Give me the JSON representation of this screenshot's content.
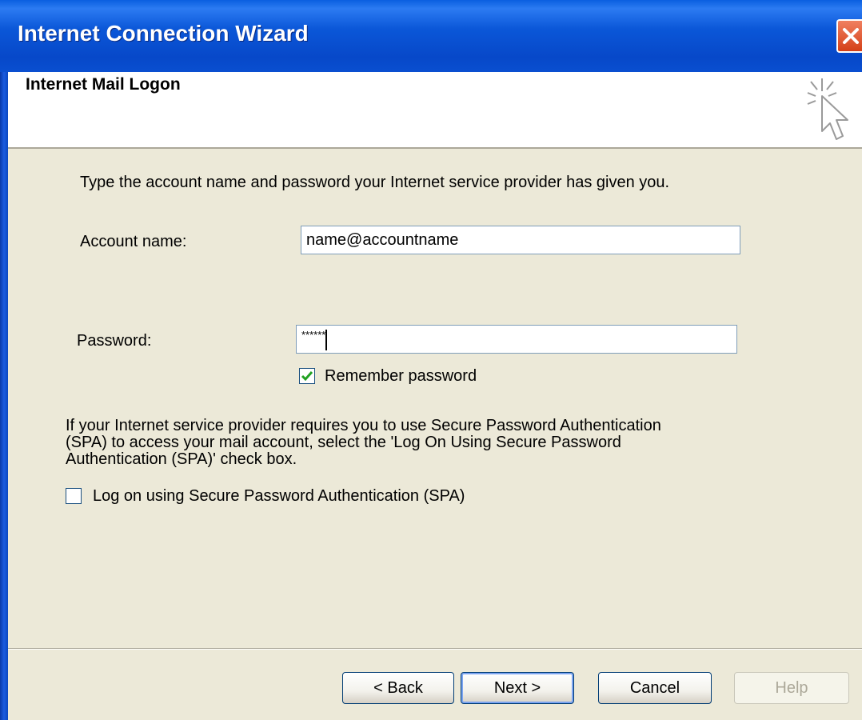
{
  "window": {
    "title": "Internet Connection Wizard"
  },
  "header": {
    "title": "Internet Mail Logon"
  },
  "content": {
    "intro": "Type the account name and password your Internet service provider has given you.",
    "account_label": "Account name:",
    "account_value": "name@accountname",
    "password_label": "Password:",
    "password_value": "******",
    "remember_label": "Remember password",
    "remember_checked": true,
    "spa_lines": [
      "If your Internet service provider requires you to use Secure Password Authentication",
      "(SPA) to access your mail account, select the 'Log On Using Secure Password",
      "Authentication (SPA)' check box."
    ],
    "spa_label": "Log on using Secure Password Authentication (SPA)",
    "spa_checked": false
  },
  "buttons": {
    "back": "< Back",
    "next": "Next >",
    "cancel": "Cancel",
    "help": "Help"
  },
  "colors": {
    "title_bar": "#0B57D8",
    "dialog_bg": "#ECE9D8",
    "close_button": "#D44018"
  },
  "icons": {
    "close": "close-icon",
    "wizard": "sparkle-cursor-icon",
    "check": "checkmark-icon"
  }
}
